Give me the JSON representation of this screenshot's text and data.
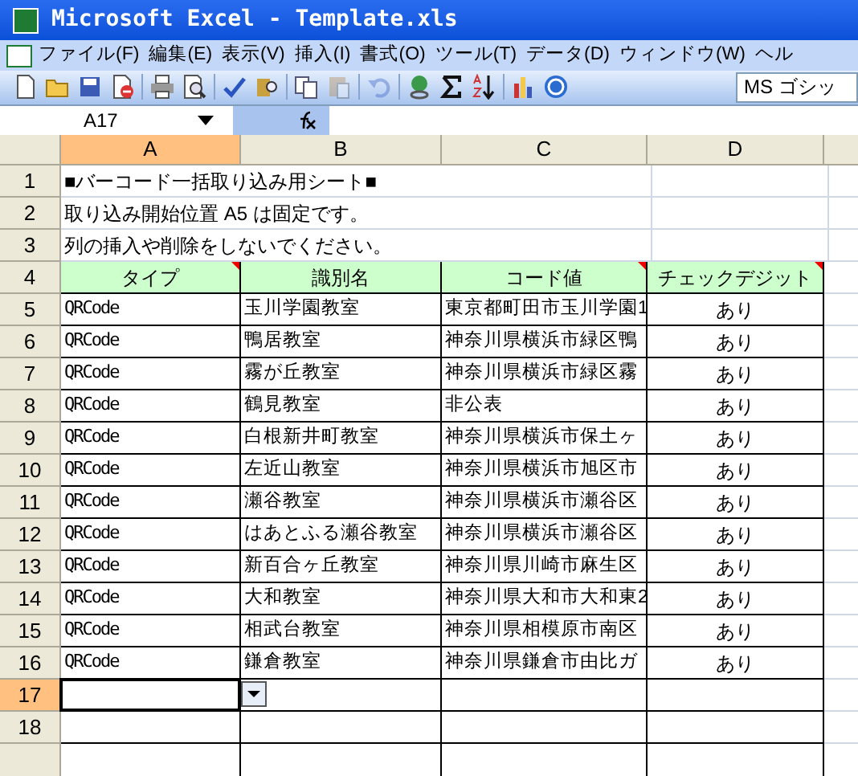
{
  "window": {
    "title": "Microsoft Excel - Template.xls"
  },
  "menu": [
    "ファイル(F)",
    "編集(E)",
    "表示(V)",
    "挿入(I)",
    "書式(O)",
    "ツール(T)",
    "データ(D)",
    "ウィンドウ(W)",
    "ヘル"
  ],
  "toolbar": {
    "font_box": "MS ゴシッ",
    "icons": [
      {
        "kind": "new",
        "disabled": false
      },
      {
        "kind": "open",
        "disabled": false
      },
      {
        "kind": "save",
        "disabled": false
      },
      {
        "kind": "permission",
        "disabled": false
      },
      {
        "kind": "sep"
      },
      {
        "kind": "print",
        "disabled": false
      },
      {
        "kind": "preview",
        "disabled": false
      },
      {
        "kind": "sep"
      },
      {
        "kind": "spell",
        "disabled": false
      },
      {
        "kind": "research",
        "disabled": false
      },
      {
        "kind": "sep"
      },
      {
        "kind": "copy",
        "disabled": false
      },
      {
        "kind": "paste",
        "disabled": true
      },
      {
        "kind": "sep"
      },
      {
        "kind": "undo",
        "disabled": true
      },
      {
        "kind": "sep"
      },
      {
        "kind": "hyperlink",
        "disabled": false
      },
      {
        "kind": "sum",
        "disabled": false
      },
      {
        "kind": "sort",
        "disabled": false
      },
      {
        "kind": "sep"
      },
      {
        "kind": "chart",
        "disabled": false
      },
      {
        "kind": "help",
        "disabled": false
      }
    ]
  },
  "name_box": "A17",
  "columns": [
    {
      "label": "A",
      "selected": true
    },
    {
      "label": "B",
      "selected": false
    },
    {
      "label": "C",
      "selected": false
    },
    {
      "label": "D",
      "selected": false
    }
  ],
  "rows": [
    {
      "number": "1",
      "selected": false,
      "kind": "note",
      "text": "■バーコード一括取り込み用シート■"
    },
    {
      "number": "2",
      "selected": false,
      "kind": "note",
      "text": "取り込み開始位置 A5 は固定です。"
    },
    {
      "number": "3",
      "selected": false,
      "kind": "note",
      "text": "列の挿入や削除をしないでください。"
    },
    {
      "number": "4",
      "selected": false,
      "kind": "header",
      "cells": [
        {
          "text": "タイプ",
          "comment": true
        },
        {
          "text": "識別名",
          "comment": false
        },
        {
          "text": "コード値",
          "comment": true
        },
        {
          "text": "チェックデジット",
          "comment": true
        }
      ]
    },
    {
      "number": "5",
      "selected": false,
      "kind": "data",
      "cells": [
        "QRCode",
        "玉川学園教室",
        "東京都町田市玉川学園1",
        "あり"
      ]
    },
    {
      "number": "6",
      "selected": false,
      "kind": "data",
      "cells": [
        "QRCode",
        "鴨居教室",
        "神奈川県横浜市緑区鴨",
        "あり"
      ]
    },
    {
      "number": "7",
      "selected": false,
      "kind": "data",
      "cells": [
        "QRCode",
        "霧が丘教室",
        "神奈川県横浜市緑区霧",
        "あり"
      ]
    },
    {
      "number": "8",
      "selected": false,
      "kind": "data",
      "cells": [
        "QRCode",
        "鶴見教室",
        "非公表",
        "あり"
      ]
    },
    {
      "number": "9",
      "selected": false,
      "kind": "data",
      "cells": [
        "QRCode",
        "白根新井町教室",
        "神奈川県横浜市保土ヶ",
        "あり"
      ]
    },
    {
      "number": "10",
      "selected": false,
      "kind": "data",
      "cells": [
        "QRCode",
        "左近山教室",
        "神奈川県横浜市旭区市",
        "あり"
      ]
    },
    {
      "number": "11",
      "selected": false,
      "kind": "data",
      "cells": [
        "QRCode",
        "瀬谷教室",
        "神奈川県横浜市瀬谷区",
        "あり"
      ]
    },
    {
      "number": "12",
      "selected": false,
      "kind": "data",
      "cells": [
        "QRCode",
        "はあとふる瀬谷教室",
        "神奈川県横浜市瀬谷区",
        "あり"
      ]
    },
    {
      "number": "13",
      "selected": false,
      "kind": "data",
      "cells": [
        "QRCode",
        "新百合ヶ丘教室",
        "神奈川県川崎市麻生区",
        "あり"
      ]
    },
    {
      "number": "14",
      "selected": false,
      "kind": "data",
      "cells": [
        "QRCode",
        "大和教室",
        "神奈川県大和市大和東2",
        "あり"
      ]
    },
    {
      "number": "15",
      "selected": false,
      "kind": "data",
      "cells": [
        "QRCode",
        "相武台教室",
        "神奈川県相模原市南区",
        "あり"
      ]
    },
    {
      "number": "16",
      "selected": false,
      "kind": "data",
      "cells": [
        "QRCode",
        "鎌倉教室",
        "神奈川県鎌倉市由比ガ",
        "あり"
      ]
    },
    {
      "number": "17",
      "selected": true,
      "kind": "empty"
    },
    {
      "number": "18",
      "selected": false,
      "kind": "empty"
    }
  ]
}
